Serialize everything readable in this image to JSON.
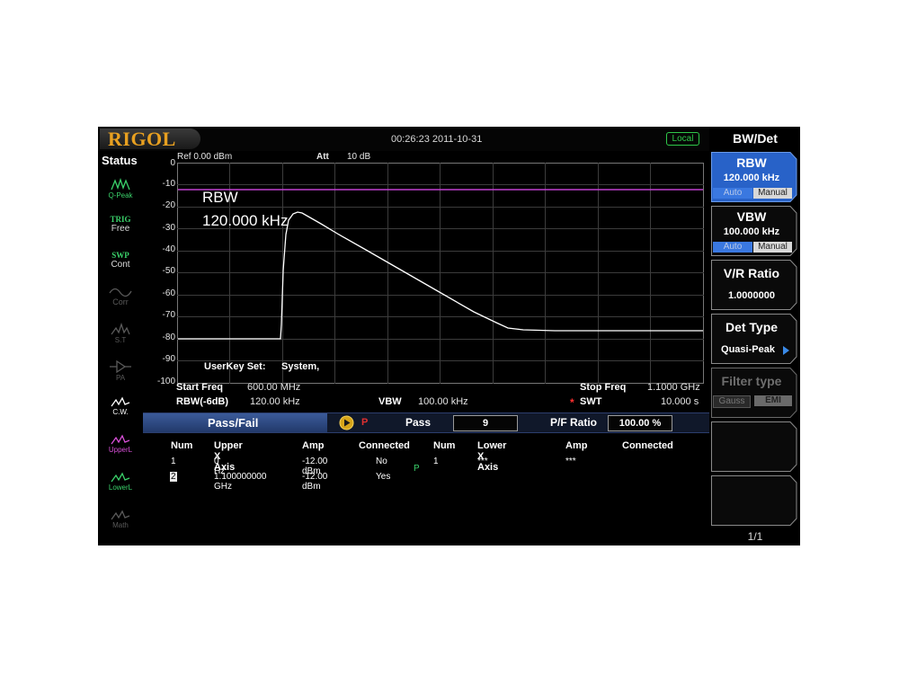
{
  "header": {
    "logo": "RIGOL",
    "datetime": "00:26:23 2011-10-31",
    "local_badge": "Local"
  },
  "status": {
    "title": "Status",
    "items": [
      {
        "line1": "",
        "line2": "Q-Peak",
        "icon": "detector-wave-icon",
        "color": "#3ad16a"
      },
      {
        "line1": "TRIG",
        "line2": "Free",
        "icon": "",
        "color": "#3ad16a"
      },
      {
        "line1": "SWP",
        "line2": "Cont",
        "icon": "",
        "color": "#3ad16a"
      },
      {
        "line1": "",
        "line2": "Corr",
        "icon": "correction-icon",
        "color": "#5a5a5a"
      },
      {
        "line1": "",
        "line2": "S.T",
        "icon": "signal-track-icon",
        "color": "#5a5a5a"
      },
      {
        "line1": "",
        "line2": "PA",
        "icon": "preamp-icon",
        "color": "#5a5a5a"
      },
      {
        "line1": "",
        "line2": "C.W.",
        "icon": "trace-icon",
        "color": "#ffffff"
      },
      {
        "line1": "",
        "line2": "UpperL",
        "icon": "upper-limit-icon",
        "color": "#d84fd8"
      },
      {
        "line1": "",
        "line2": "LowerL",
        "icon": "lower-limit-icon",
        "color": "#3ad16a"
      },
      {
        "line1": "",
        "line2": "Math",
        "icon": "math-icon",
        "color": "#5a5a5a"
      }
    ]
  },
  "graph": {
    "ref": "Ref 0.00 dBm",
    "att_label": "Att",
    "att_value": "10 dB",
    "y_ticks": [
      "0",
      "-10",
      "-20",
      "-30",
      "-40",
      "-50",
      "-60",
      "-70",
      "-80",
      "-90",
      "-100"
    ],
    "overlay_rbw_label": "RBW",
    "overlay_rbw_value": "120.000 kHz",
    "userkey_label": "UserKey Set:",
    "userkey_value": "System,",
    "limit_line_color": "#c040d0",
    "trace_color": "#ffffff"
  },
  "footer": {
    "start_freq_label": "Start Freq",
    "start_freq_value": "600.00 MHz",
    "stop_freq_label": "Stop Freq",
    "stop_freq_value": "1.1000 GHz",
    "rbw_label": "RBW(-6dB)",
    "rbw_value": "120.00 kHz",
    "vbw_label": "VBW",
    "vbw_value": "100.00 kHz",
    "swt_marker": "*",
    "swt_label": "SWT",
    "swt_value": "10.000 s"
  },
  "passfail": {
    "tab_label": "Pass/Fail",
    "status_letter": "P",
    "pass_label": "Pass",
    "pass_value": "9",
    "ratio_label": "P/F Ratio",
    "ratio_value": "100.00 %"
  },
  "table": {
    "upper_headers": [
      "Num",
      "Upper X Axis",
      "Amp",
      "Connected"
    ],
    "lower_headers": [
      "Num",
      "Lower X Axis",
      "Amp",
      "Connected"
    ],
    "upper_rows": [
      {
        "num": "1",
        "x": "0 Hz",
        "amp": "-12.00 dBm",
        "connected": "No"
      },
      {
        "num": "2",
        "x": "1.100000000 GHz",
        "amp": "-12.00 dBm",
        "connected": "Yes"
      }
    ],
    "lower_rows": [
      {
        "num": "1",
        "x": "***",
        "amp": "***",
        "connected": ""
      }
    ],
    "mid_marker": "P"
  },
  "menu": {
    "title": "BW/Det",
    "rbw": {
      "title": "RBW",
      "value": "120.000 kHz",
      "opt_auto": "Auto",
      "opt_manual": "Manual"
    },
    "vbw": {
      "title": "VBW",
      "value": "100.000 kHz",
      "opt_auto": "Auto",
      "opt_manual": "Manual"
    },
    "vr_ratio": {
      "title": "V/R Ratio",
      "value": "1.0000000"
    },
    "det_type": {
      "title": "Det Type",
      "value": "Quasi-Peak"
    },
    "filter_type": {
      "title": "Filter type",
      "opt_gauss": "Gauss",
      "opt_emi": "EMI"
    },
    "page": "1/1"
  }
}
